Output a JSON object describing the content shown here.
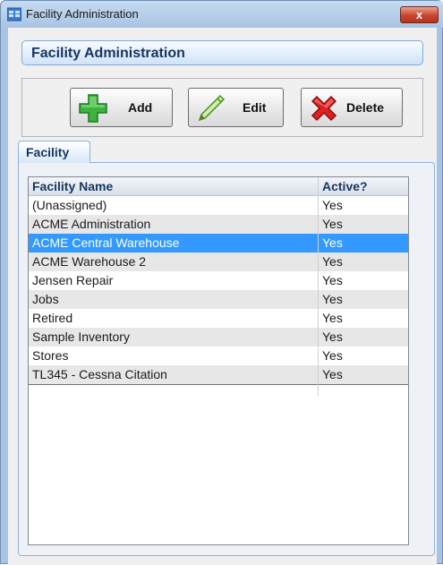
{
  "window": {
    "title": "Facility Administration",
    "close_label": "x"
  },
  "header": {
    "title": "Facility Administration"
  },
  "toolbar": {
    "add_label": "Add",
    "edit_label": "Edit",
    "delete_label": "Delete"
  },
  "tab": {
    "label": "Facility"
  },
  "table": {
    "columns": [
      "Facility Name",
      "Active?"
    ],
    "rows": [
      {
        "name": "(Unassigned)",
        "active": "Yes"
      },
      {
        "name": "ACME Administration",
        "active": "Yes"
      },
      {
        "name": "ACME Central Warehouse",
        "active": "Yes"
      },
      {
        "name": "ACME Warehouse 2",
        "active": "Yes"
      },
      {
        "name": "Jensen Repair",
        "active": "Yes"
      },
      {
        "name": "Jobs",
        "active": "Yes"
      },
      {
        "name": "Retired",
        "active": "Yes"
      },
      {
        "name": "Sample Inventory",
        "active": "Yes"
      },
      {
        "name": "Stores",
        "active": "Yes"
      },
      {
        "name": "TL345 - Cessna Citation",
        "active": "Yes"
      }
    ],
    "selected_row": 2
  },
  "icons": {
    "app": "window-app-icon",
    "add": "plus-icon",
    "edit": "pencil-icon",
    "delete": "red-x-icon"
  },
  "colors": {
    "selection": "#3399ff",
    "header_text": "#16355d",
    "add_icon": "#3cb43c",
    "delete_icon": "#e02020"
  }
}
